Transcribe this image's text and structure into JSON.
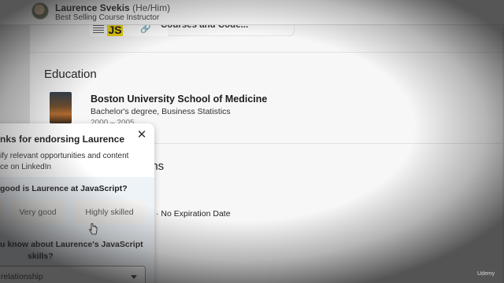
{
  "header": {
    "name": "Laurence Svekis",
    "pronouns": "(He/Him)",
    "headline": "Best Selling Course Instructor"
  },
  "featured": {
    "tile_text": "JS",
    "title": "Courses and Code..."
  },
  "education": {
    "heading": "Education",
    "school": "Boston University School of Medicine",
    "degree": "Bachelor's degree, Business Statistics",
    "dates": "2000 – 2005"
  },
  "certifications": {
    "heading_partial": "ons",
    "meta": "· No Expiration Date"
  },
  "endorse_popup": {
    "title": "nks for endorsing Laurence",
    "close_icon": "close-icon",
    "desc_line1": "ify relevant opportunities and content",
    "desc_line2": "ce on LinkedIn",
    "question1": "good is Laurence at JavaScript?",
    "options": [
      "",
      "Very good",
      "Highly skilled"
    ],
    "question2_line1": "u know about Laurence's JavaScript",
    "question2_line2": "skills?",
    "select_value": "relationship"
  },
  "watermark": "Udemy",
  "colors": {
    "accent_js": "#f5d800",
    "question_band": "#eef3f8"
  }
}
